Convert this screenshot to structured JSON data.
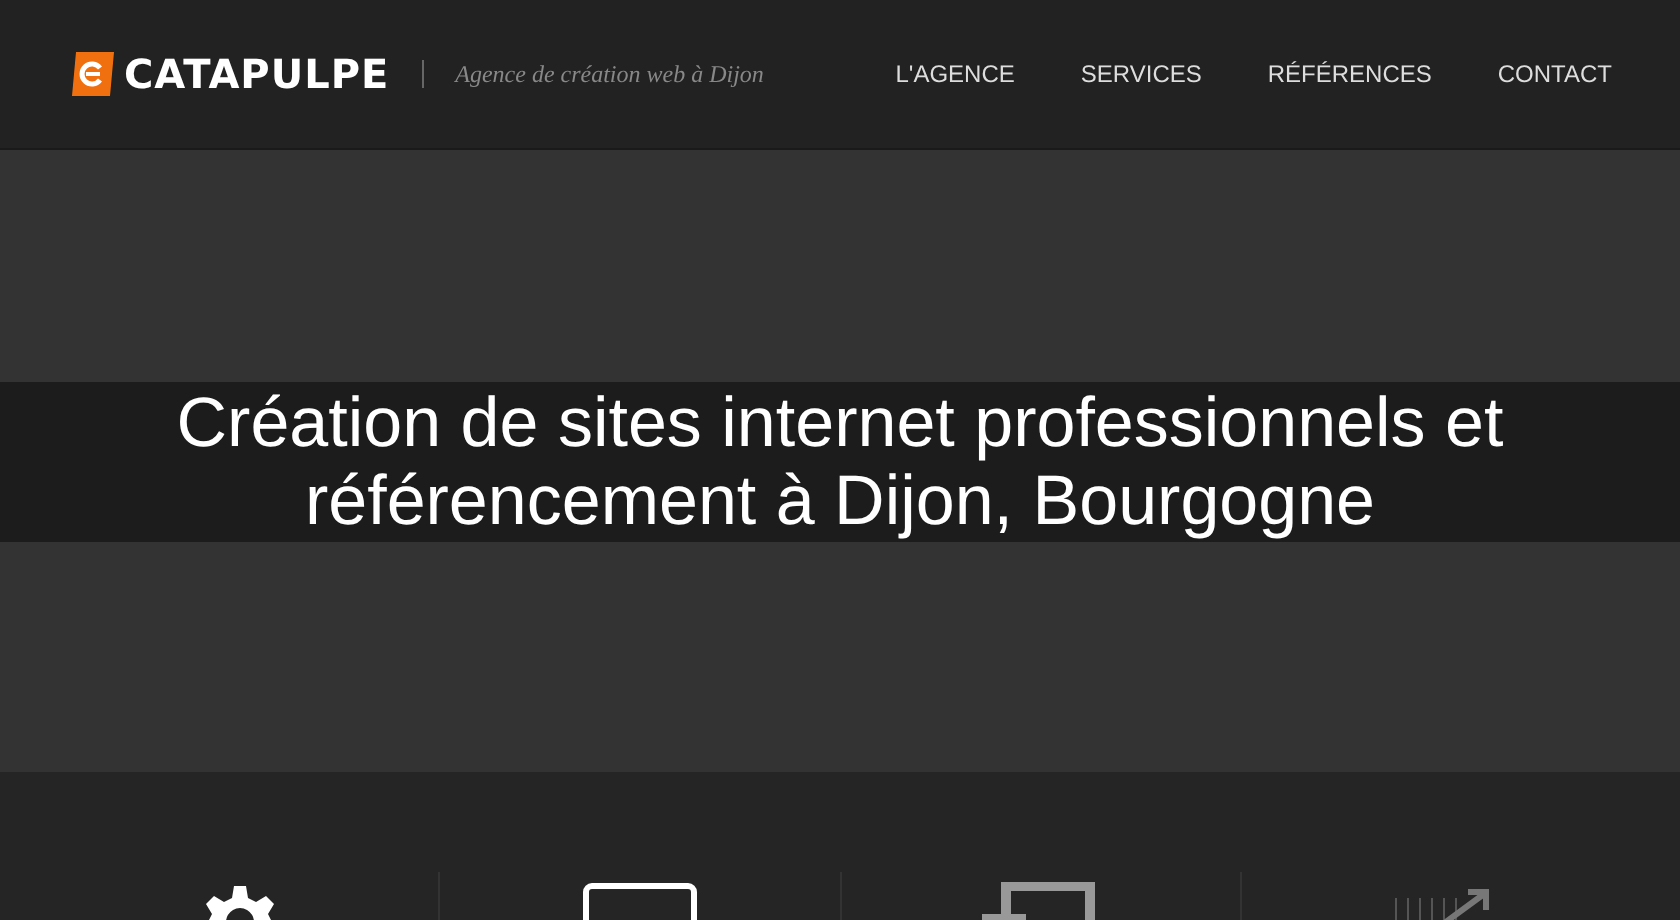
{
  "header": {
    "logo": "CATAPULPE",
    "tagline": "Agence de création web à Dijon"
  },
  "nav": [
    {
      "label": "L'AGENCE"
    },
    {
      "label": "SERVICES"
    },
    {
      "label": "RÉFÉRENCES"
    },
    {
      "label": "CONTACT"
    }
  ],
  "hero": {
    "title": "Création de sites internet professionnels et référencement à Dijon, Bourgogne"
  },
  "features": [
    {
      "kind": "gear"
    },
    {
      "kind": "monitor"
    },
    {
      "kind": "devices"
    },
    {
      "kind": "chart"
    }
  ]
}
